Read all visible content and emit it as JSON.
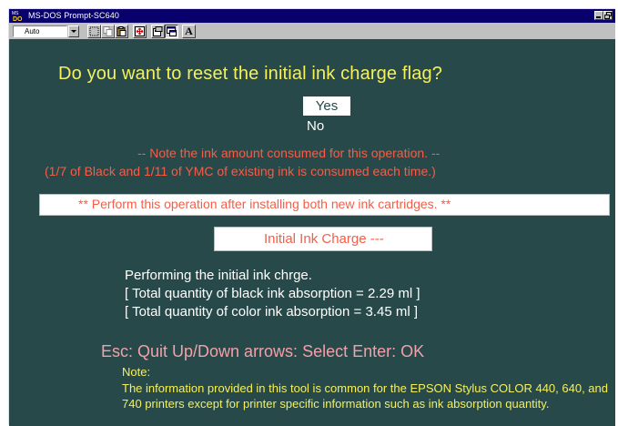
{
  "window": {
    "title": "MS-DOS Prompt-SC640",
    "title_icon": "ms-dos-icon",
    "controls": [
      "minimize-icon",
      "restore-icon"
    ]
  },
  "toolbar": {
    "font_size": "Auto",
    "tools": [
      "mark-icon",
      "copy-icon",
      "paste-icon",
      "full-screen-icon",
      "properties-icon",
      "background-icon",
      "font-icon"
    ],
    "font_button_label": "A"
  },
  "dialog": {
    "question": "Do you want to reset the initial ink charge flag?",
    "options": [
      {
        "label": "Yes",
        "selected": true
      },
      {
        "label": "No",
        "selected": false
      }
    ],
    "note_line1": "-- Note the ink amount consumed for this operation. --",
    "note_line2": "(1/7 of Black and 1/11 of YMC of existing ink is consumed each time.)",
    "warning": "** Perform this operation after installing both new ink cartridges. **",
    "section_title": "Initial Ink Charge ---",
    "status_lines": [
      "Performing the initial ink chrge.",
      "[   Total quantity of black ink absorption = 2.29 ml   ]",
      "[   Total quantity of color ink absorption = 3.45 ml ]"
    ],
    "key_help": "Esc: Quit  Up/Down arrows: Select  Enter: OK",
    "note_label": "Note:",
    "note_text": "The information provided in this tool is common for the EPSON Stylus COLOR 440, 640, and 740 printers except for printer specific information such as ink absorption quantity."
  },
  "colors": {
    "screen_bg": "#27494a",
    "question": "#f5f05c",
    "note": "#f55d48",
    "key_help": "#f2a1a8",
    "titlebar": "#08006b"
  }
}
